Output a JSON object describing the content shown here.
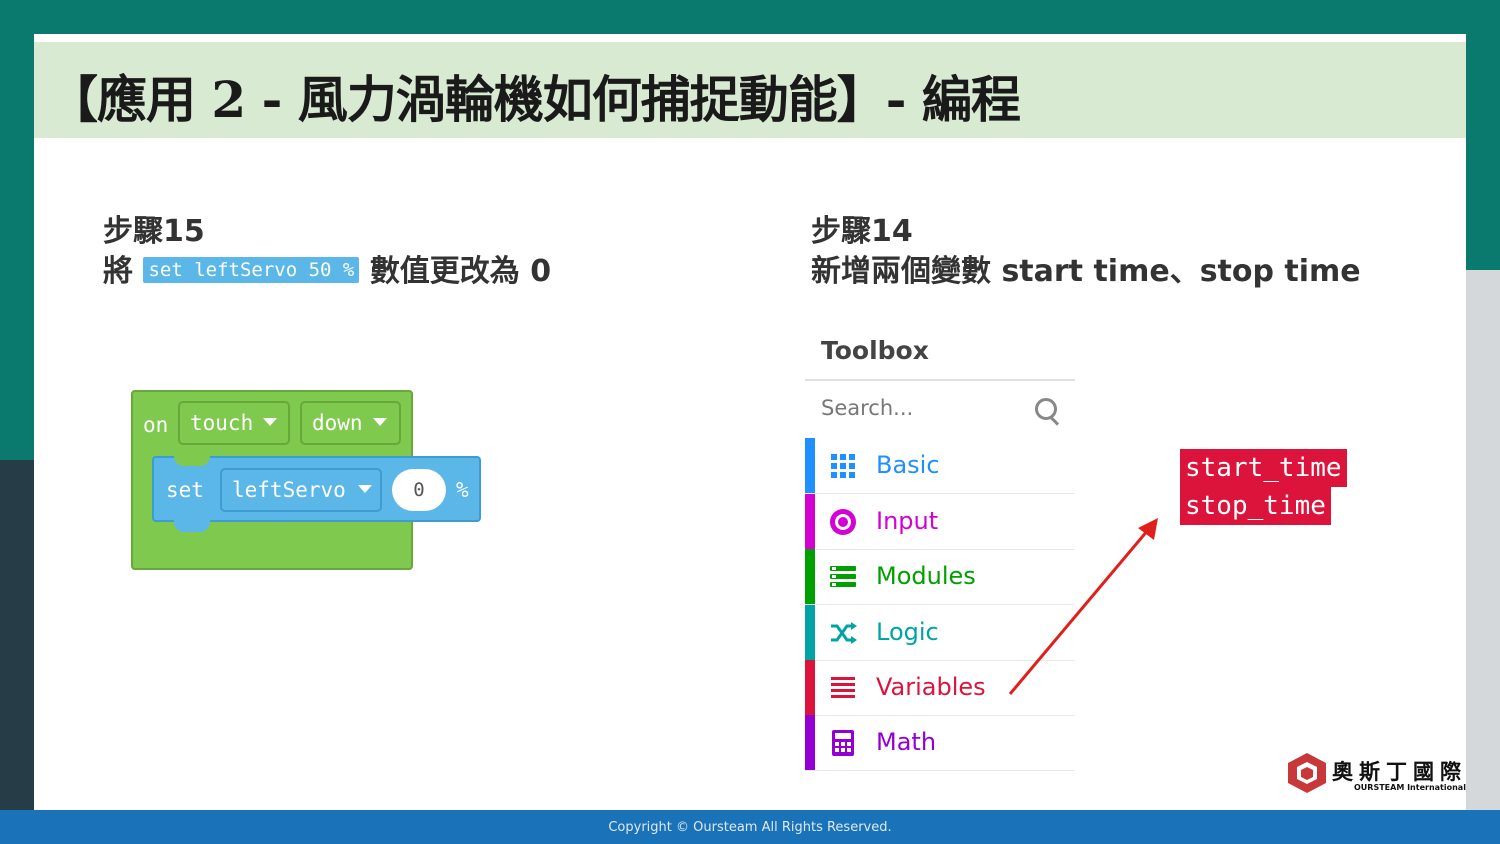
{
  "slide": {
    "title": "【應用 2 - 風力渦輪機如何捕捉動能】- 編程"
  },
  "left_step": {
    "heading": "步驟15",
    "prefix": "將",
    "inline_block": "set leftServo 50 %",
    "suffix": "數值更改為 0"
  },
  "right_step": {
    "heading": "步驟14",
    "text": "新增兩個變數 start time、stop time"
  },
  "code_block": {
    "event": "on",
    "event_dropdown": "touch",
    "event_state": "down",
    "action": "set",
    "servo": "leftServo",
    "value": "0",
    "unit": "%"
  },
  "toolbox": {
    "title": "Toolbox",
    "search_placeholder": "Search...",
    "categories": [
      {
        "label": "Basic",
        "color": "#1e90ff",
        "icon": "grid-icon"
      },
      {
        "label": "Input",
        "color": "#d400d4",
        "icon": "target-icon"
      },
      {
        "label": "Modules",
        "color": "#00a000",
        "icon": "stack-icon"
      },
      {
        "label": "Logic",
        "color": "#00a4a6",
        "icon": "shuffle-icon"
      },
      {
        "label": "Variables",
        "color": "#dc143c",
        "icon": "list-icon"
      },
      {
        "label": "Math",
        "color": "#9400d3",
        "icon": "calculator-icon"
      }
    ]
  },
  "variables": [
    "start_time",
    "stop_time"
  ],
  "footer": {
    "copyright": "Copyright © Oursteam All Rights Reserved."
  },
  "logo": {
    "name_cn": "奧斯丁國際",
    "name_en": "OURSTEAM International"
  }
}
